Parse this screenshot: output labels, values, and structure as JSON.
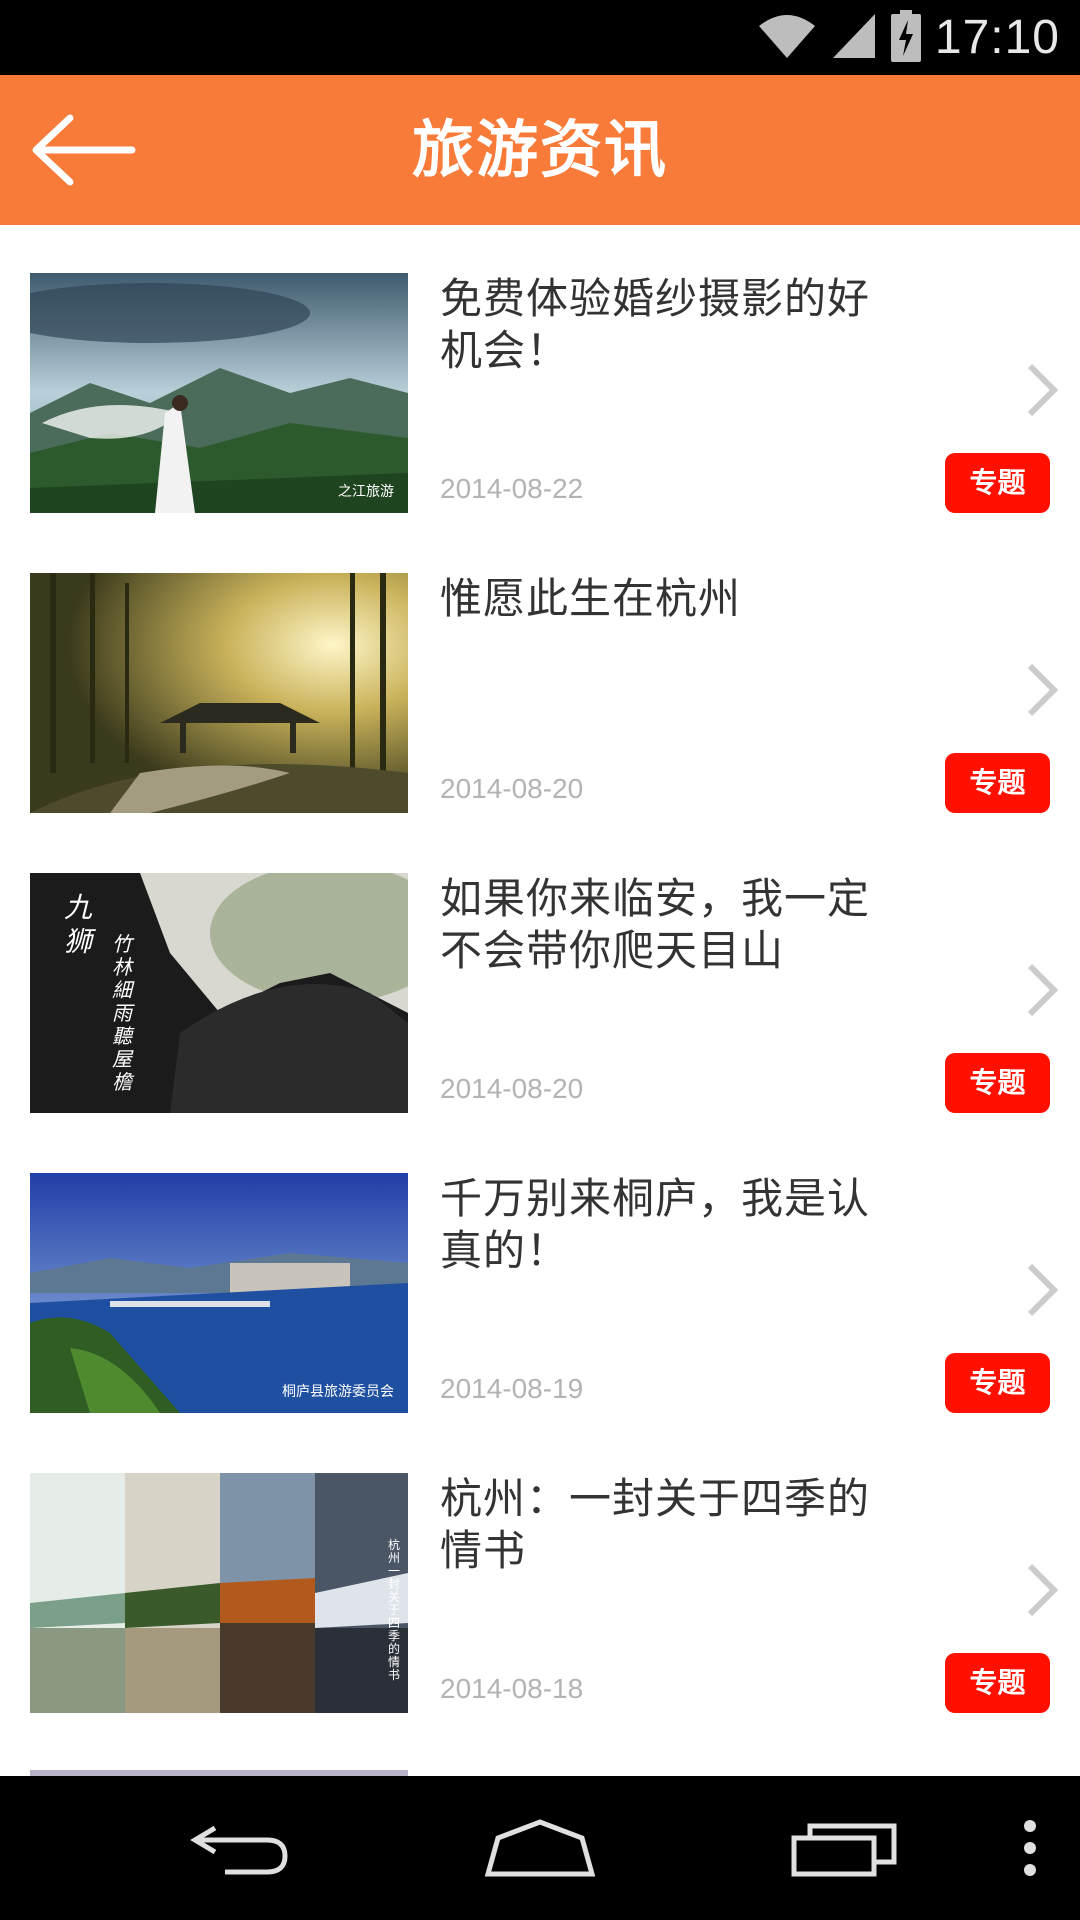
{
  "status_bar": {
    "time": "17:10"
  },
  "header": {
    "title": "旅游资讯",
    "back_icon": "arrow-left-icon"
  },
  "articles": [
    {
      "title": "免费体验婚纱摄影的好机会！",
      "date": "2014-08-22",
      "badge": "专题",
      "watermark": "之江旅游"
    },
    {
      "title": "惟愿此生在杭州",
      "date": "2014-08-20",
      "badge": "专题"
    },
    {
      "title": "如果你来临安，我一定不会带你爬天目山",
      "date": "2014-08-20",
      "badge": "专题",
      "calligraphy_left": "九狮",
      "calligraphy_right": "竹林細雨聽屋檐"
    },
    {
      "title": "千万别来桐庐，我是认真的！",
      "date": "2014-08-19",
      "badge": "专题",
      "watermark": "桐庐县旅游委员会"
    },
    {
      "title": "杭州：一封关于四季的情书",
      "date": "2014-08-18",
      "badge": "专题",
      "vertical_text": "杭州 一封关于四季的情书"
    }
  ],
  "colors": {
    "header": "#f97b3a",
    "badge": "#ff1000",
    "date": "#b3b3b3"
  }
}
